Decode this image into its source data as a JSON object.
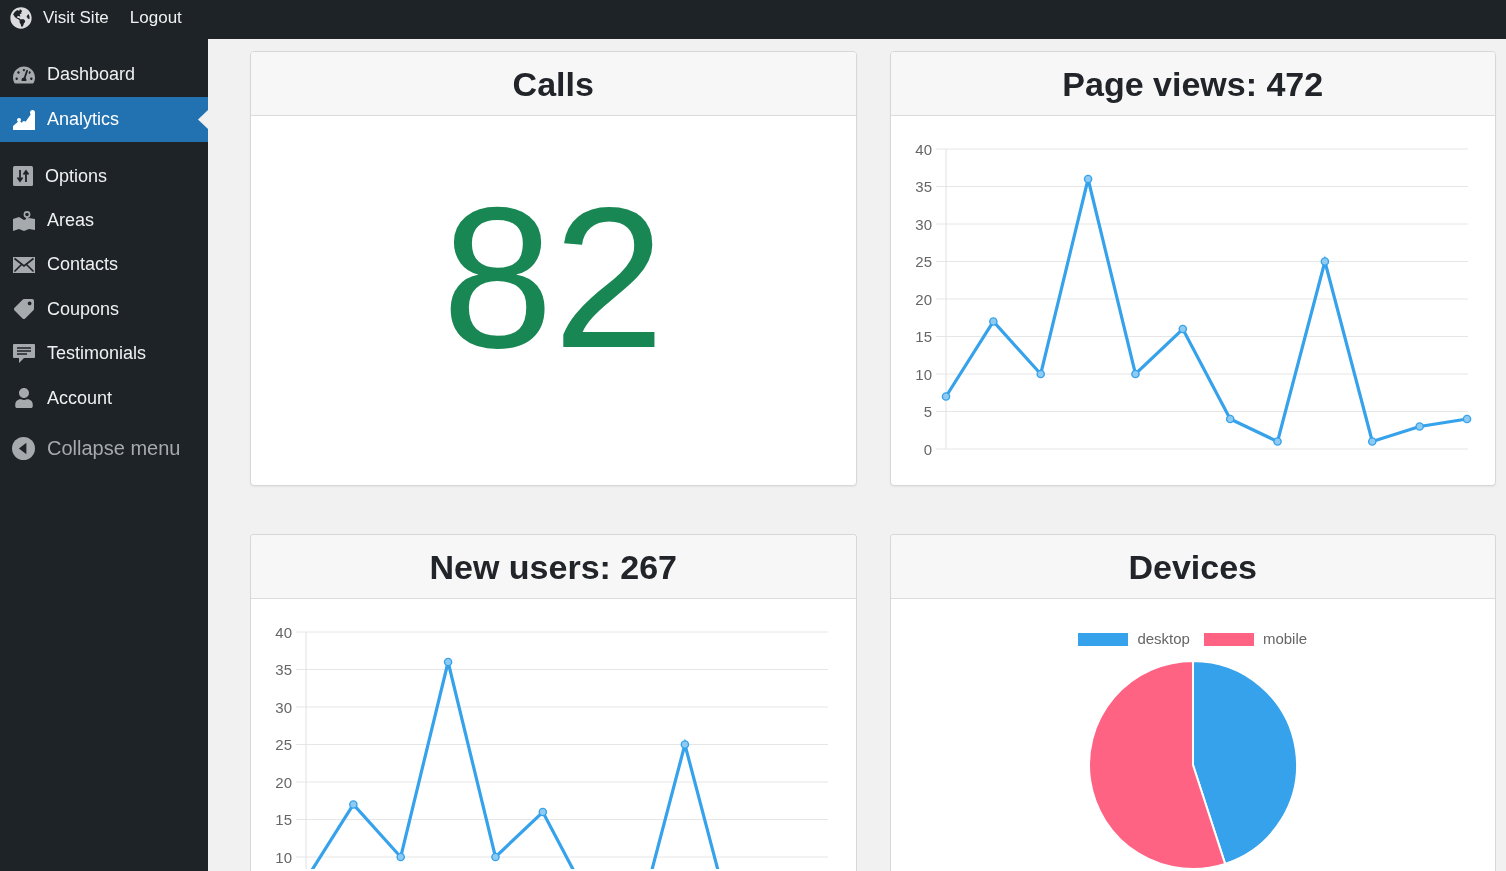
{
  "top_bar": {
    "site_link": "Visit Site",
    "logout_link": "Logout"
  },
  "sidebar": {
    "groups": [
      {
        "items": [
          {
            "label": "Dashboard",
            "selected": false
          },
          {
            "label": "Analytics",
            "selected": true
          }
        ]
      },
      {
        "items": [
          {
            "label": "Options",
            "selected": false
          },
          {
            "label": "Areas",
            "selected": false
          },
          {
            "label": "Contacts",
            "selected": false
          },
          {
            "label": "Coupons",
            "selected": false
          },
          {
            "label": "Testimonials",
            "selected": false
          },
          {
            "label": "Account",
            "selected": false
          }
        ]
      }
    ],
    "collapse_label": "Collapse menu"
  },
  "cards": [
    {
      "kind": "number",
      "title": "Calls",
      "value": "82"
    },
    {
      "kind": "line",
      "title": "Page views: 472",
      "chart_data": {
        "type": "line",
        "grid": true,
        "ylim": [
          0,
          40
        ],
        "yticks": [
          0,
          5,
          10,
          15,
          20,
          25,
          30,
          35,
          40
        ],
        "series": [
          {
            "color": "#36a2eb",
            "marker": true,
            "values": [
              7,
              17,
              10,
              36,
              10,
              16,
              4,
              1,
              25,
              1,
              3,
              4
            ]
          }
        ]
      }
    },
    {
      "kind": "line",
      "title": "New users: 267",
      "chart_data": {
        "type": "line",
        "grid": true,
        "ylim": [
          0,
          40
        ],
        "yticks": [
          10,
          15,
          20,
          25,
          30,
          35,
          40
        ],
        "series": [
          {
            "color": "#36a2eb",
            "marker": true,
            "values": [
              7,
              17,
              10,
              36,
              10,
              16,
              4,
              1,
              25,
              1,
              null,
              null
            ]
          }
        ]
      }
    },
    {
      "kind": "pie",
      "title": "Devices",
      "legend": [
        {
          "label": "desktop",
          "color": "#36a2eb"
        },
        {
          "label": "mobile",
          "color": "#ff6384"
        }
      ]
    }
  ]
}
